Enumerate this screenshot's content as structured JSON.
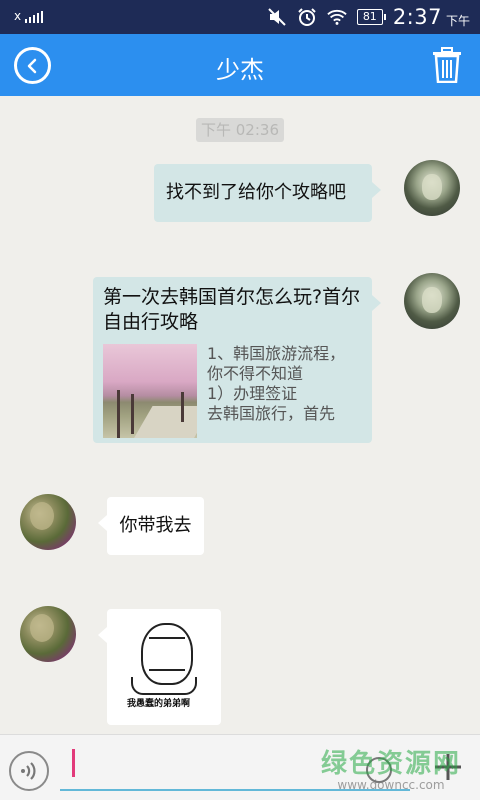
{
  "status_bar": {
    "carrier": "x",
    "battery": "81",
    "time": "2:37",
    "ampm": "下午",
    "icons": [
      "signal-icon",
      "mute-icon",
      "alarm-icon",
      "wifi-icon",
      "battery-icon"
    ]
  },
  "header": {
    "title": "少杰",
    "back_icon": "back-arrow-icon",
    "delete_icon": "trash-icon",
    "background_color": "#2c8fef"
  },
  "chat": {
    "timestamp": "下午 02:36",
    "messages": [
      {
        "from": "me",
        "type": "text",
        "text": "找不到了给你个攻略吧"
      },
      {
        "from": "me",
        "type": "link_card",
        "title": "第一次去韩国首尔怎么玩?首尔自由行攻略",
        "lines": [
          "1、韩国旅游流程，",
          "你不得不知道",
          "1）办理签证",
          "去韩国旅行，首先"
        ]
      },
      {
        "from": "friend",
        "type": "text",
        "text": "你带我去"
      },
      {
        "from": "friend",
        "type": "sticker",
        "caption": "我愚蠢的弟弟啊"
      }
    ]
  },
  "input_bar": {
    "voice_icon": "voice-icon",
    "emoji_icon": "emoji-icon",
    "add_icon": "plus-icon",
    "watermark": "绿色资源网",
    "watermark_url": "www.downcc.com"
  }
}
